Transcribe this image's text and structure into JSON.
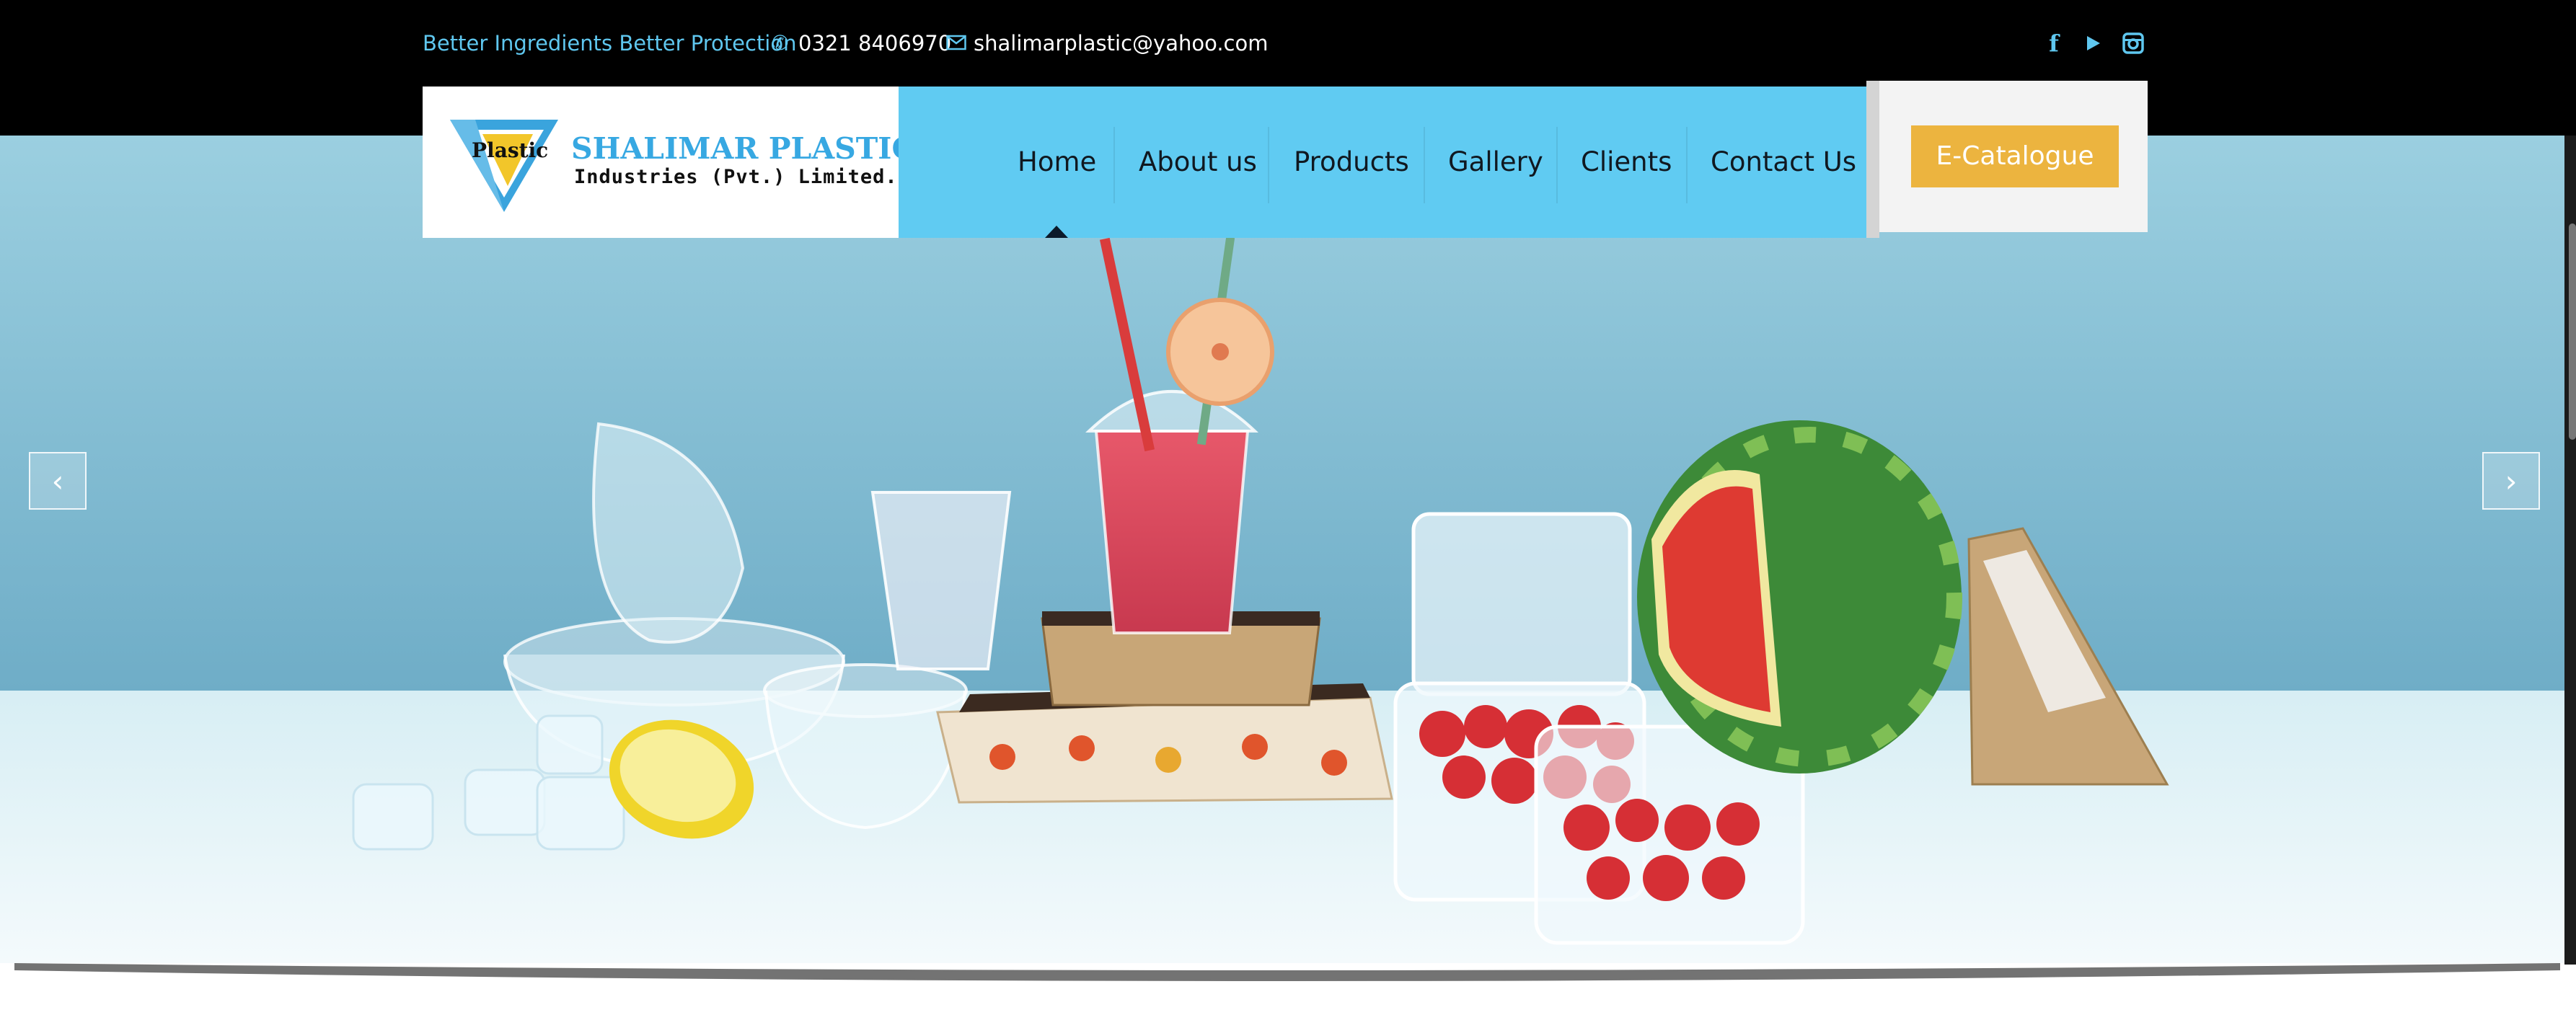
{
  "topbar": {
    "tagline": "Better Ingredients Better Protection",
    "phone_icon": "phone-icon",
    "phone": "0321 8406970",
    "mail_icon": "mail-icon",
    "email": "shalimarplastic@yahoo.com",
    "social": [
      "facebook-icon",
      "youtube-icon",
      "instagram-icon"
    ]
  },
  "logo": {
    "badge_text": "Plastic",
    "title": "SHALIMAR PLASTIC",
    "subtitle": "Industries (Pvt.) Limited."
  },
  "nav": {
    "items": [
      "Home",
      "About us",
      "Products",
      "Gallery",
      "Clients",
      "Contact Us"
    ],
    "active": "Home"
  },
  "catalogue_button": "E-Catalogue",
  "slider": {
    "prev_label": "‹",
    "next_label": "›"
  },
  "colors": {
    "accent_blue": "#60cbf2",
    "tagline_blue": "#5fc7ef",
    "catalogue_orange": "#ecb43f",
    "top_band": "#000000"
  }
}
